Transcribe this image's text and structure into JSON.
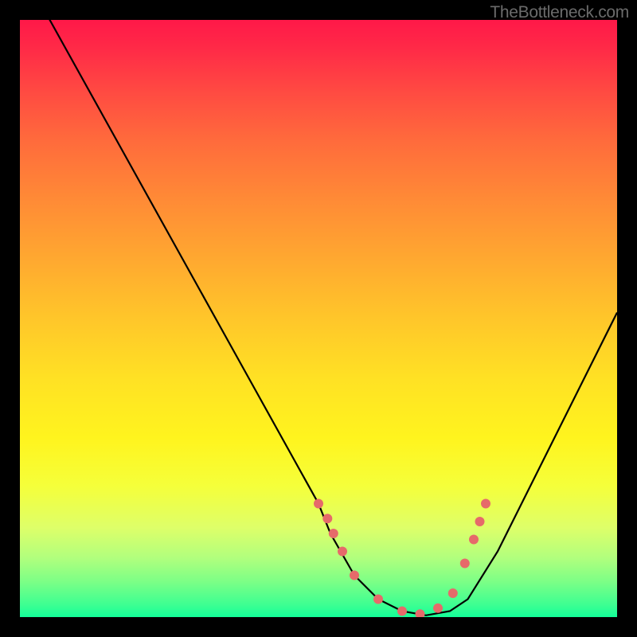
{
  "watermark": "TheBottleneck.com",
  "chart_data": {
    "type": "line",
    "title": "",
    "xlabel": "",
    "ylabel": "",
    "xlim": [
      0,
      100
    ],
    "ylim": [
      0,
      100
    ],
    "series": [
      {
        "name": "curve",
        "x": [
          0,
          5,
          10,
          15,
          20,
          25,
          30,
          35,
          40,
          45,
          50,
          52,
          56,
          60,
          64,
          68,
          72,
          75,
          80,
          85,
          90,
          95,
          100
        ],
        "values": [
          109,
          100,
          91,
          82,
          73,
          64,
          55,
          46,
          37,
          28,
          19,
          14,
          7,
          3,
          1,
          0.3,
          1,
          3,
          11,
          21,
          31,
          41,
          51
        ]
      }
    ],
    "markers": {
      "name": "dots",
      "color": "#e66a6a",
      "x": [
        50,
        51.5,
        52.5,
        54,
        56,
        60,
        64,
        67,
        70,
        72.5,
        74.5,
        76,
        77,
        78
      ],
      "values": [
        19,
        16.5,
        14,
        11,
        7,
        3,
        1,
        0.5,
        1.5,
        4,
        9,
        13,
        16,
        19
      ]
    },
    "gradient_stops": [
      {
        "pos": 0,
        "color": "#ff1848"
      },
      {
        "pos": 50,
        "color": "#ffc62a"
      },
      {
        "pos": 80,
        "color": "#f5ff3a"
      },
      {
        "pos": 100,
        "color": "#13ff99"
      }
    ]
  }
}
